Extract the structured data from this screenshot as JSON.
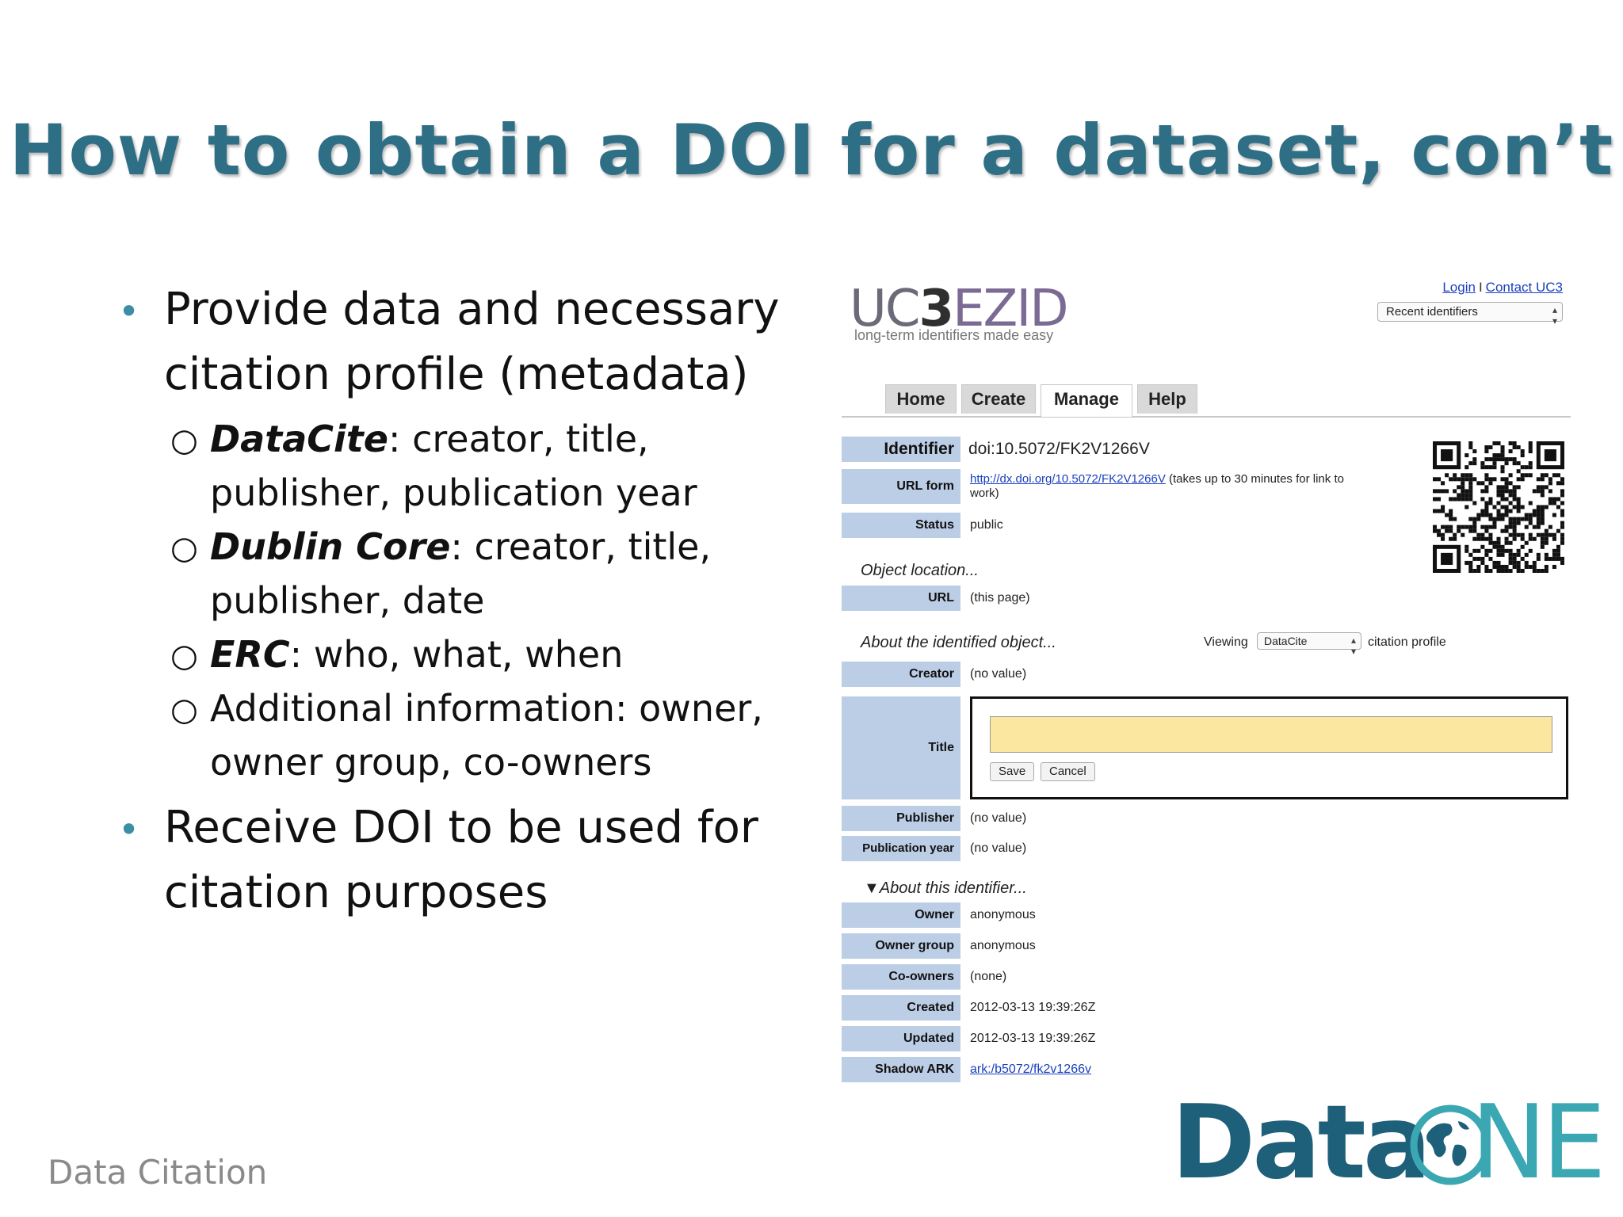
{
  "title": "How to obtain a DOI for a dataset, con’t",
  "bullets": [
    {
      "text": "Provide data and necessary citation profile (metadata)"
    },
    {
      "text": "Receive DOI to be used for citation purposes"
    }
  ],
  "subbullets": [
    {
      "key": "DataCite",
      "rest": ": creator, title, publisher, publication year"
    },
    {
      "key": "Dublin Core",
      "rest": ": creator, title, publisher, date"
    },
    {
      "key": "ERC",
      "rest": ": who, what, when"
    },
    {
      "key": "",
      "rest": "Additional information: owner, owner group, co-owners"
    }
  ],
  "footer": "Data Citation",
  "ezid": {
    "logo_uc": "UC",
    "logo_3": "3",
    "logo_ezid": "EZID",
    "tagline": "long-term identifiers made easy",
    "login": "Login",
    "sep": "I",
    "contact": "Contact UC3",
    "recent": "Recent identifiers",
    "tabs": [
      "Home",
      "Create",
      "Manage",
      "Help"
    ],
    "identifier_label": "Identifier",
    "identifier_value": "doi:10.5072/FK2V1266V",
    "urlform_label": "URL form",
    "urlform_link": "http://dx.doi.org/10.5072/FK2V1266V",
    "urlform_note": " (takes up to 30 minutes for link to",
    "urlform_note2": "work)",
    "status_label": "Status",
    "status_value": "public",
    "object_location": "Object location...",
    "url_label": "URL",
    "url_value": "(this page)",
    "about_object": "About the identified object...",
    "viewing": "Viewing",
    "profile": "DataCite",
    "citation_profile": "citation profile",
    "creator_label": "Creator",
    "creator_value": "(no value)",
    "title_label": "Title",
    "save": "Save",
    "cancel": "Cancel",
    "publisher_label": "Publisher",
    "publisher_value": "(no value)",
    "pubyear_label": "Publication year",
    "pubyear_value": "(no value)",
    "about_identifier": "▼About this identifier...",
    "owner_label": "Owner",
    "owner_value": "anonymous",
    "ownergroup_label": "Owner group",
    "ownergroup_value": "anonymous",
    "coowners_label": "Co-owners",
    "coowners_value": "(none)",
    "created_label": "Created",
    "created_value": "2012-03-13 19:39:26Z",
    "updated_label": "Updated",
    "updated_value": "2012-03-13 19:39:26Z",
    "shadow_label": "Shadow ARK",
    "shadow_value": "ark:/b5072/fk2v1266v"
  },
  "dataone": {
    "data": "Data",
    "ne": "NE"
  }
}
